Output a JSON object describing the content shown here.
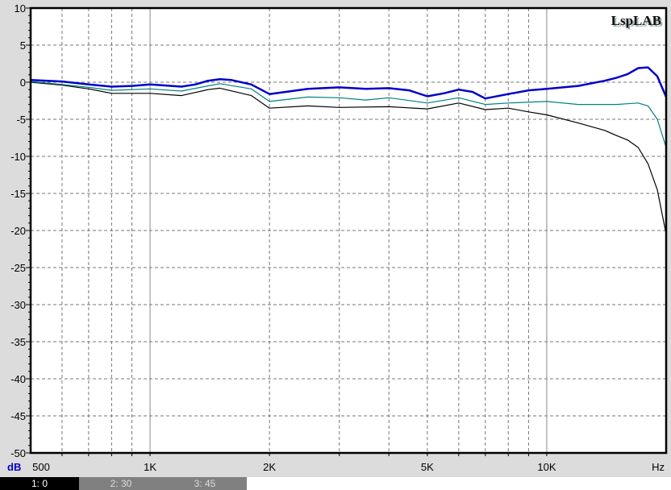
{
  "logo": "LspLAB",
  "chart_data": {
    "type": "line",
    "title": "",
    "xlabel": "Hz",
    "ylabel": "dB",
    "xscale": "log",
    "xlim": [
      500,
      20000
    ],
    "ylim": [
      -50,
      10
    ],
    "yticks": [
      10,
      5,
      0,
      -5,
      -10,
      -15,
      -20,
      -25,
      -30,
      -35,
      -40,
      -45,
      -50
    ],
    "xticks": [
      {
        "v": 500,
        "label": "500"
      },
      {
        "v": 1000,
        "label": "1K"
      },
      {
        "v": 2000,
        "label": "2K"
      },
      {
        "v": 5000,
        "label": "5K"
      },
      {
        "v": 10000,
        "label": "10K"
      }
    ],
    "grid": true,
    "series": [
      {
        "name": "1: 0",
        "color": "#0000c8",
        "x": [
          500,
          600,
          700,
          800,
          900,
          1000,
          1200,
          1300,
          1400,
          1500,
          1600,
          1800,
          2000,
          2200,
          2500,
          3000,
          3500,
          4000,
          4500,
          5000,
          5500,
          6000,
          6500,
          7000,
          8000,
          9000,
          10000,
          12000,
          14000,
          15000,
          16000,
          17000,
          18000,
          19000,
          20000
        ],
        "y": [
          0.3,
          0.1,
          -0.3,
          -0.6,
          -0.5,
          -0.3,
          -0.6,
          -0.3,
          0.2,
          0.4,
          0.3,
          -0.3,
          -1.6,
          -1.3,
          -0.9,
          -0.7,
          -0.9,
          -0.8,
          -1.1,
          -1.9,
          -1.5,
          -1.0,
          -1.3,
          -2.2,
          -1.6,
          -1.1,
          -0.9,
          -0.5,
          0.2,
          0.6,
          1.1,
          1.9,
          2.0,
          0.8,
          -2.0
        ]
      },
      {
        "name": "2: 30",
        "color": "#008080",
        "x": [
          500,
          600,
          700,
          800,
          1000,
          1200,
          1400,
          1500,
          1800,
          2000,
          2500,
          3000,
          3500,
          4000,
          5000,
          6000,
          7000,
          8000,
          10000,
          12000,
          15000,
          16000,
          17000,
          18000,
          19000,
          20000
        ],
        "y": [
          0.1,
          -0.3,
          -0.7,
          -1.1,
          -0.9,
          -1.2,
          -0.5,
          -0.2,
          -0.9,
          -2.6,
          -2.0,
          -2.1,
          -2.4,
          -2.1,
          -2.8,
          -2.1,
          -3.0,
          -2.8,
          -2.6,
          -3.0,
          -3.0,
          -2.9,
          -2.8,
          -3.2,
          -5.0,
          -8.8
        ]
      },
      {
        "name": "3: 45",
        "color": "#000000",
        "x": [
          500,
          600,
          700,
          800,
          1000,
          1200,
          1400,
          1500,
          1800,
          2000,
          2500,
          3000,
          4000,
          5000,
          6000,
          7000,
          8000,
          9000,
          10000,
          12000,
          14000,
          15000,
          16000,
          17000,
          18000,
          19000,
          20000
        ],
        "y": [
          0.0,
          -0.4,
          -0.9,
          -1.5,
          -1.5,
          -1.8,
          -1.0,
          -0.8,
          -1.8,
          -3.5,
          -3.2,
          -3.4,
          -3.3,
          -3.6,
          -2.8,
          -3.7,
          -3.5,
          -4.0,
          -4.4,
          -5.5,
          -6.5,
          -7.2,
          -7.8,
          -8.8,
          -11.0,
          -14.5,
          -20.5
        ]
      }
    ]
  },
  "tabs": [
    {
      "label": "1: 0"
    },
    {
      "label": "2: 30"
    },
    {
      "label": "3: 45"
    }
  ]
}
